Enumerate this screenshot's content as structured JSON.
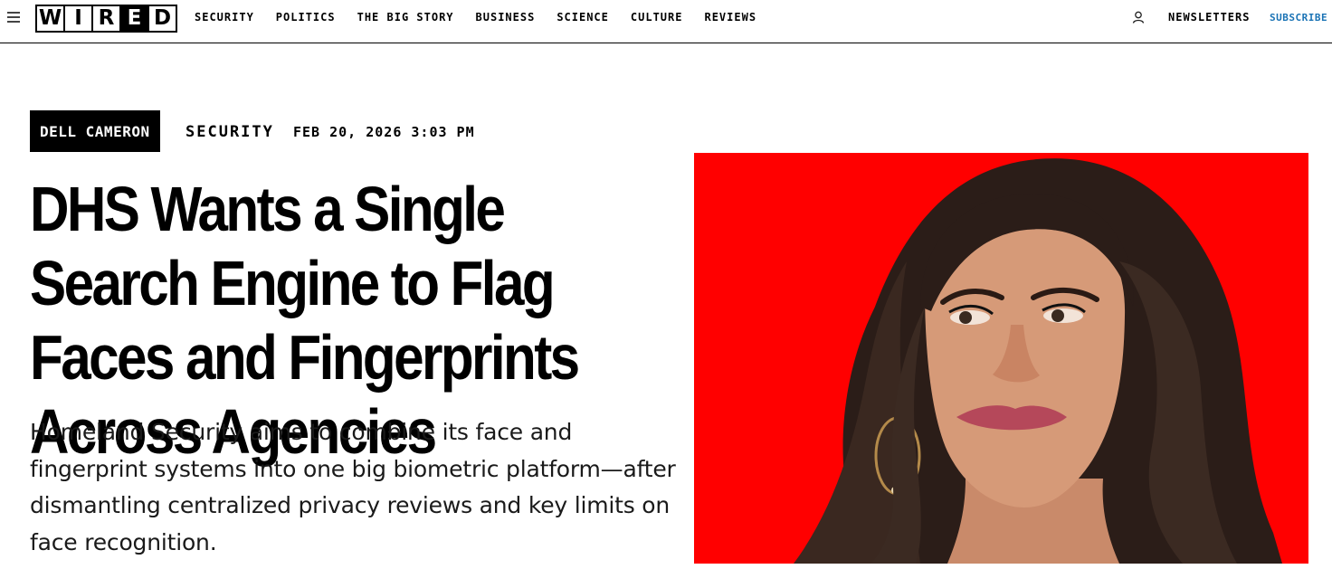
{
  "nav": {
    "logo_letters": [
      "W",
      "I",
      "R",
      "E",
      "D"
    ],
    "links": [
      "SECURITY",
      "POLITICS",
      "THE BIG STORY",
      "BUSINESS",
      "SCIENCE",
      "CULTURE",
      "REVIEWS"
    ],
    "newsletters_label": "NEWSLETTERS",
    "subscribe_label": "SUBSCRIBE",
    "menu_icon": "hamburger-icon",
    "account_icon": "user-icon"
  },
  "article": {
    "author": "DELL CAMERON",
    "section": "SECURITY",
    "date": "FEB 20, 2026 3:03 PM",
    "headline": "DHS Wants a Single Search Engine to Flag Faces and Fingerprints Across Agencies",
    "dek": "Homeland Security aims to combine its face and fingerprint systems into one big biometric platform—after dismantling centralized privacy reviews and key limits on face recognition."
  },
  "colors": {
    "accent_link": "#1a73b5",
    "image_background": "#ff0000",
    "rule": "#000000"
  }
}
